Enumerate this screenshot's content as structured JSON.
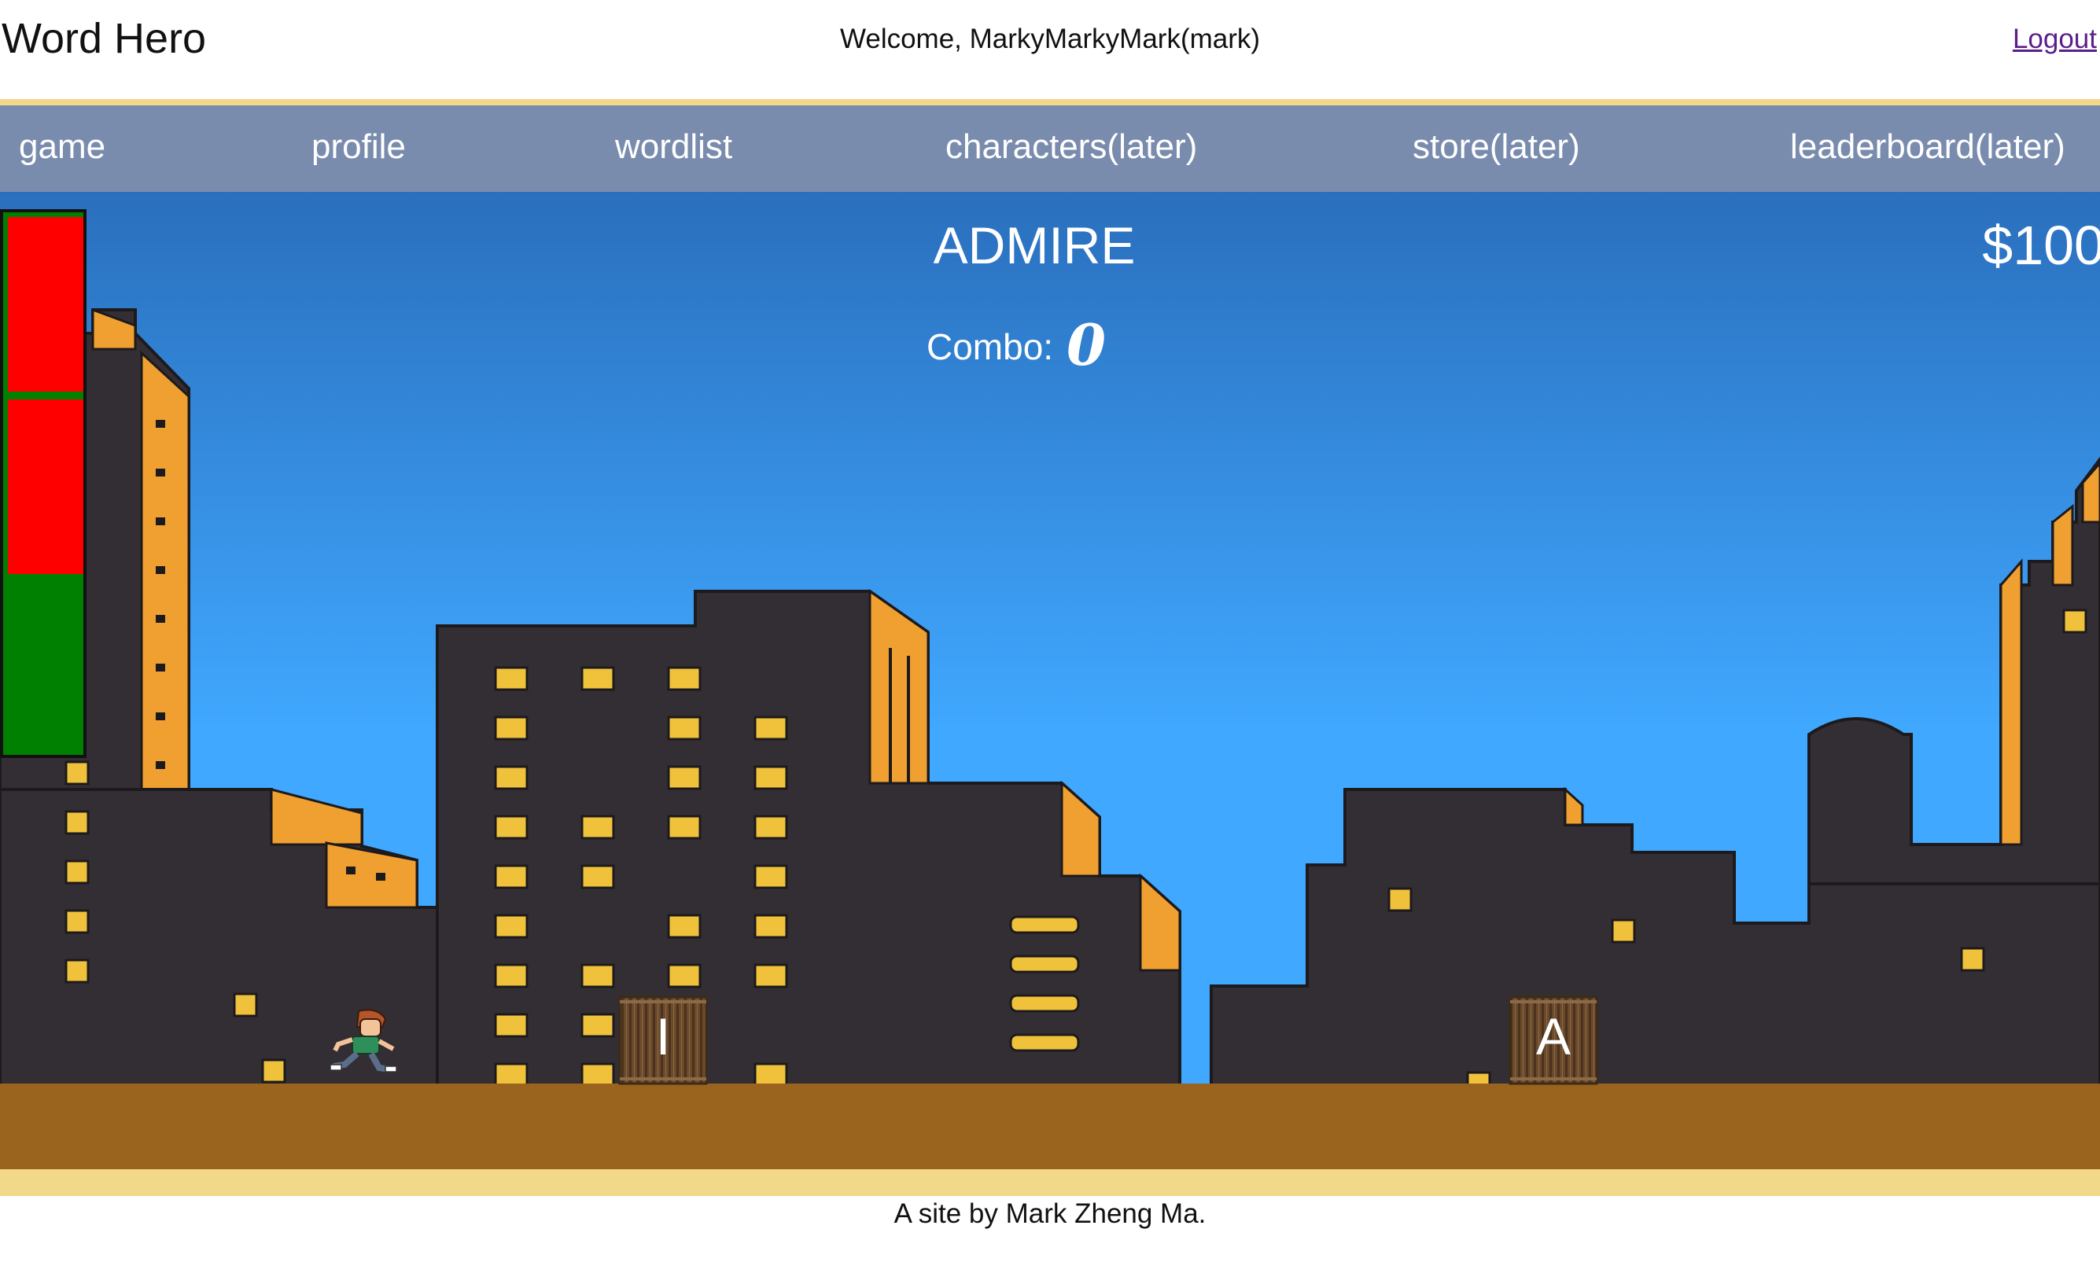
{
  "header": {
    "title": "Word Hero",
    "welcome": "Welcome, MarkyMarkyMark(mark)",
    "logout": "Logout"
  },
  "nav": {
    "items": [
      {
        "label": "game"
      },
      {
        "label": "profile"
      },
      {
        "label": "wordlist"
      },
      {
        "label": "characters(later)"
      },
      {
        "label": "store(later)"
      },
      {
        "label": "leaderboard(later)"
      }
    ]
  },
  "game": {
    "target_word": "ADMIRE",
    "money": "$100",
    "combo_label": "Combo:",
    "combo_value": "0",
    "crates": [
      {
        "letter": "I"
      },
      {
        "letter": "A"
      }
    ],
    "health": {
      "lost_segments": 2,
      "total_segments": 3
    },
    "colors": {
      "sky_top": "#2a6fbd",
      "sky_bottom": "#40a8ff",
      "building": "#332e33",
      "window": "#f0c23c",
      "accent": "#f0a030",
      "ground": "#9a641f",
      "health_full": "#008000",
      "health_lost": "#ff0000"
    }
  },
  "footer": {
    "text": "A site by Mark Zheng Ma."
  }
}
